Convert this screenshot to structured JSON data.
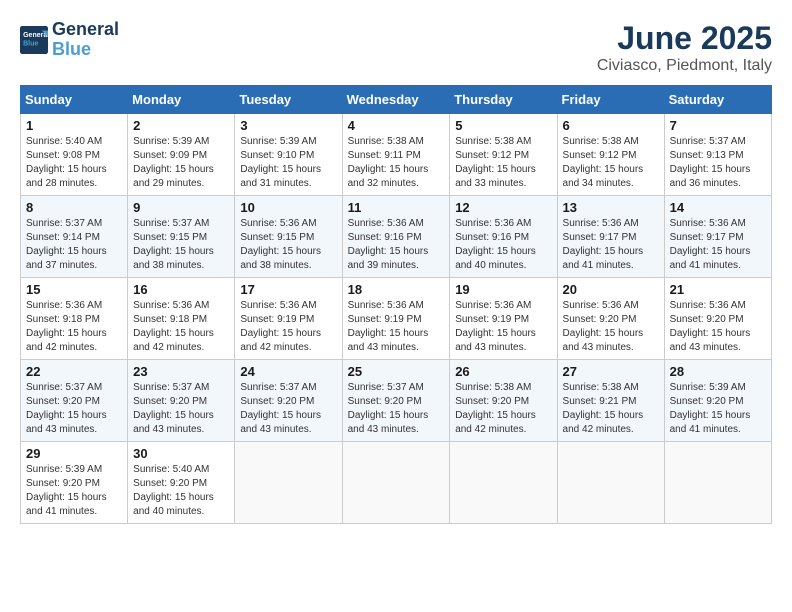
{
  "logo": {
    "line1": "General",
    "line2": "Blue"
  },
  "title": "June 2025",
  "location": "Civiasco, Piedmont, Italy",
  "weekdays": [
    "Sunday",
    "Monday",
    "Tuesday",
    "Wednesday",
    "Thursday",
    "Friday",
    "Saturday"
  ],
  "weeks": [
    [
      {
        "day": "1",
        "sunrise": "5:40 AM",
        "sunset": "9:08 PM",
        "daylight": "15 hours and 28 minutes."
      },
      {
        "day": "2",
        "sunrise": "5:39 AM",
        "sunset": "9:09 PM",
        "daylight": "15 hours and 29 minutes."
      },
      {
        "day": "3",
        "sunrise": "5:39 AM",
        "sunset": "9:10 PM",
        "daylight": "15 hours and 31 minutes."
      },
      {
        "day": "4",
        "sunrise": "5:38 AM",
        "sunset": "9:11 PM",
        "daylight": "15 hours and 32 minutes."
      },
      {
        "day": "5",
        "sunrise": "5:38 AM",
        "sunset": "9:12 PM",
        "daylight": "15 hours and 33 minutes."
      },
      {
        "day": "6",
        "sunrise": "5:38 AM",
        "sunset": "9:12 PM",
        "daylight": "15 hours and 34 minutes."
      },
      {
        "day": "7",
        "sunrise": "5:37 AM",
        "sunset": "9:13 PM",
        "daylight": "15 hours and 36 minutes."
      }
    ],
    [
      {
        "day": "8",
        "sunrise": "5:37 AM",
        "sunset": "9:14 PM",
        "daylight": "15 hours and 37 minutes."
      },
      {
        "day": "9",
        "sunrise": "5:37 AM",
        "sunset": "9:15 PM",
        "daylight": "15 hours and 38 minutes."
      },
      {
        "day": "10",
        "sunrise": "5:36 AM",
        "sunset": "9:15 PM",
        "daylight": "15 hours and 38 minutes."
      },
      {
        "day": "11",
        "sunrise": "5:36 AM",
        "sunset": "9:16 PM",
        "daylight": "15 hours and 39 minutes."
      },
      {
        "day": "12",
        "sunrise": "5:36 AM",
        "sunset": "9:16 PM",
        "daylight": "15 hours and 40 minutes."
      },
      {
        "day": "13",
        "sunrise": "5:36 AM",
        "sunset": "9:17 PM",
        "daylight": "15 hours and 41 minutes."
      },
      {
        "day": "14",
        "sunrise": "5:36 AM",
        "sunset": "9:17 PM",
        "daylight": "15 hours and 41 minutes."
      }
    ],
    [
      {
        "day": "15",
        "sunrise": "5:36 AM",
        "sunset": "9:18 PM",
        "daylight": "15 hours and 42 minutes."
      },
      {
        "day": "16",
        "sunrise": "5:36 AM",
        "sunset": "9:18 PM",
        "daylight": "15 hours and 42 minutes."
      },
      {
        "day": "17",
        "sunrise": "5:36 AM",
        "sunset": "9:19 PM",
        "daylight": "15 hours and 42 minutes."
      },
      {
        "day": "18",
        "sunrise": "5:36 AM",
        "sunset": "9:19 PM",
        "daylight": "15 hours and 43 minutes."
      },
      {
        "day": "19",
        "sunrise": "5:36 AM",
        "sunset": "9:19 PM",
        "daylight": "15 hours and 43 minutes."
      },
      {
        "day": "20",
        "sunrise": "5:36 AM",
        "sunset": "9:20 PM",
        "daylight": "15 hours and 43 minutes."
      },
      {
        "day": "21",
        "sunrise": "5:36 AM",
        "sunset": "9:20 PM",
        "daylight": "15 hours and 43 minutes."
      }
    ],
    [
      {
        "day": "22",
        "sunrise": "5:37 AM",
        "sunset": "9:20 PM",
        "daylight": "15 hours and 43 minutes."
      },
      {
        "day": "23",
        "sunrise": "5:37 AM",
        "sunset": "9:20 PM",
        "daylight": "15 hours and 43 minutes."
      },
      {
        "day": "24",
        "sunrise": "5:37 AM",
        "sunset": "9:20 PM",
        "daylight": "15 hours and 43 minutes."
      },
      {
        "day": "25",
        "sunrise": "5:37 AM",
        "sunset": "9:20 PM",
        "daylight": "15 hours and 43 minutes."
      },
      {
        "day": "26",
        "sunrise": "5:38 AM",
        "sunset": "9:20 PM",
        "daylight": "15 hours and 42 minutes."
      },
      {
        "day": "27",
        "sunrise": "5:38 AM",
        "sunset": "9:21 PM",
        "daylight": "15 hours and 42 minutes."
      },
      {
        "day": "28",
        "sunrise": "5:39 AM",
        "sunset": "9:20 PM",
        "daylight": "15 hours and 41 minutes."
      }
    ],
    [
      {
        "day": "29",
        "sunrise": "5:39 AM",
        "sunset": "9:20 PM",
        "daylight": "15 hours and 41 minutes."
      },
      {
        "day": "30",
        "sunrise": "5:40 AM",
        "sunset": "9:20 PM",
        "daylight": "15 hours and 40 minutes."
      },
      null,
      null,
      null,
      null,
      null
    ]
  ]
}
